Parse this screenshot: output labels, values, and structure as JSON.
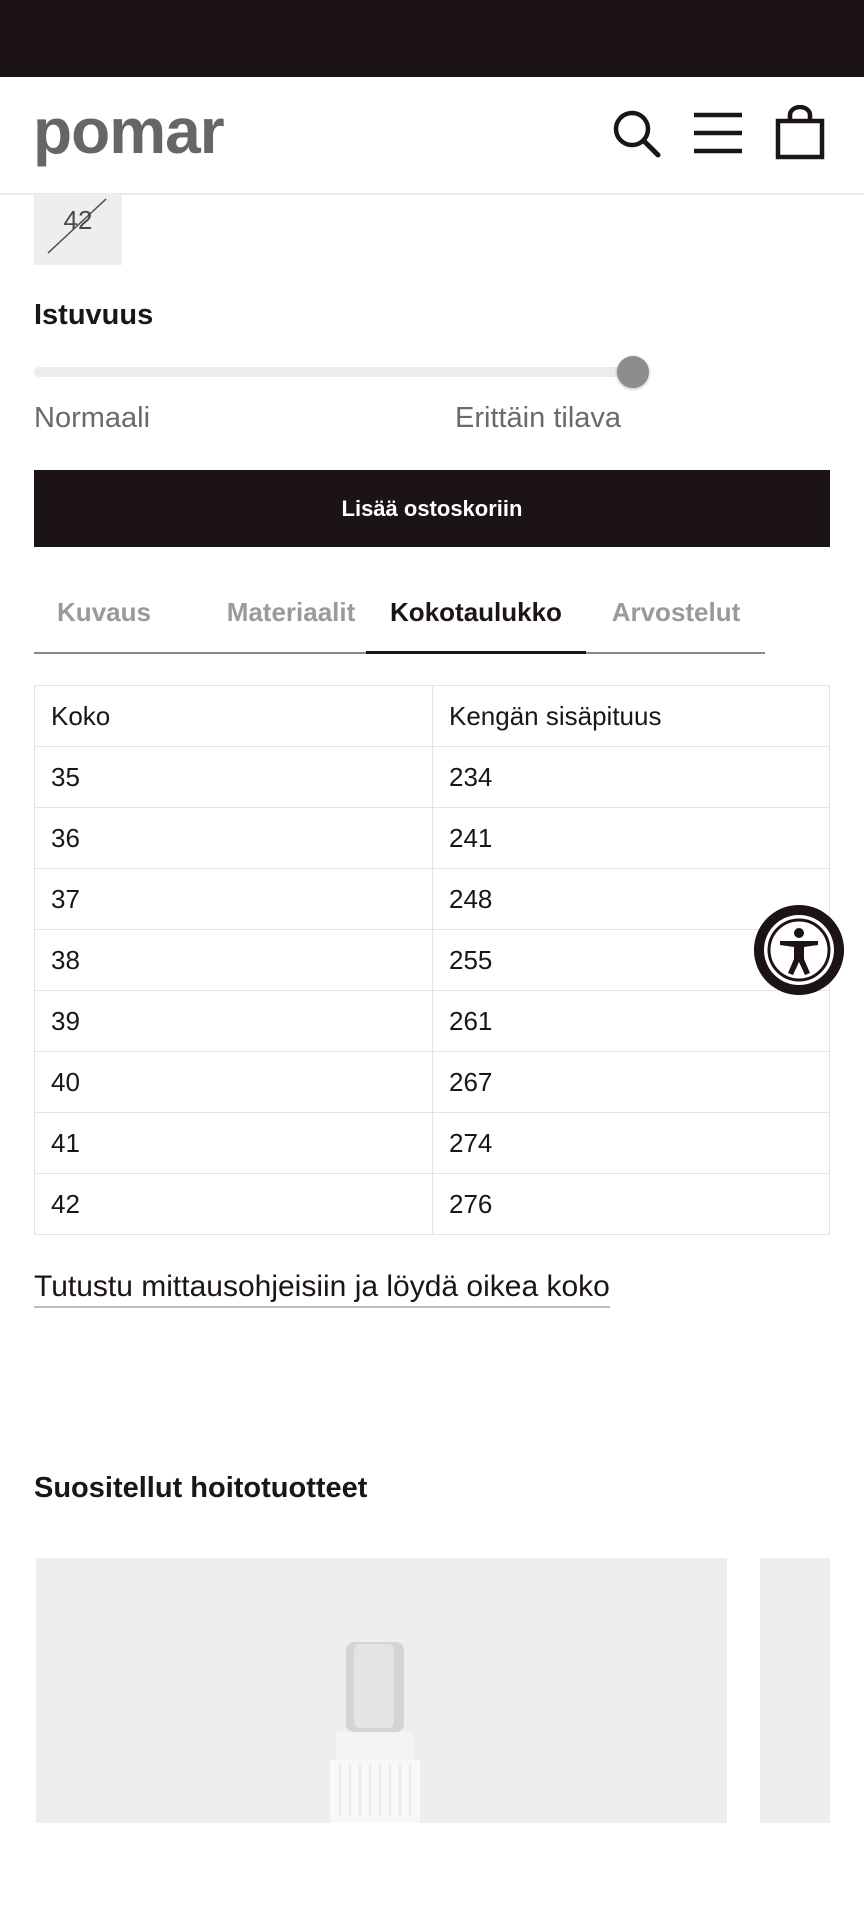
{
  "header": {
    "logo": "pomar",
    "icons": [
      "search-icon",
      "menu-icon",
      "cart-icon"
    ]
  },
  "size_selector": {
    "visible_size": "42",
    "visible_size_unavailable": true
  },
  "fit": {
    "title": "Istuvuus",
    "left_label": "Normaali",
    "right_label": "Erittäin tilava",
    "level": 1.0
  },
  "add_to_cart": {
    "label": "Lisää ostoskoriin"
  },
  "tabs": [
    {
      "label": "Kuvaus",
      "active": false
    },
    {
      "label": "Materiaalit",
      "active": false
    },
    {
      "label": "Kokotaulukko",
      "active": true
    },
    {
      "label": "Arvostelut",
      "active": false
    }
  ],
  "size_table": {
    "headers": [
      "Koko",
      "Kengän sisäpituus"
    ],
    "rows": [
      [
        "35",
        "234"
      ],
      [
        "36",
        "241"
      ],
      [
        "37",
        "248"
      ],
      [
        "38",
        "255"
      ],
      [
        "39",
        "261"
      ],
      [
        "40",
        "267"
      ],
      [
        "41",
        "274"
      ],
      [
        "42",
        "276"
      ]
    ]
  },
  "measure_link": {
    "label": "Tutustu mittausohjeisiin ja löydä oikea koko"
  },
  "care_products": {
    "title": "Suositellut hoitotuotteet"
  },
  "colors": {
    "dark": "#1c1314",
    "chip_bg": "#efeeec",
    "muted_text": "#6a6a6a"
  }
}
